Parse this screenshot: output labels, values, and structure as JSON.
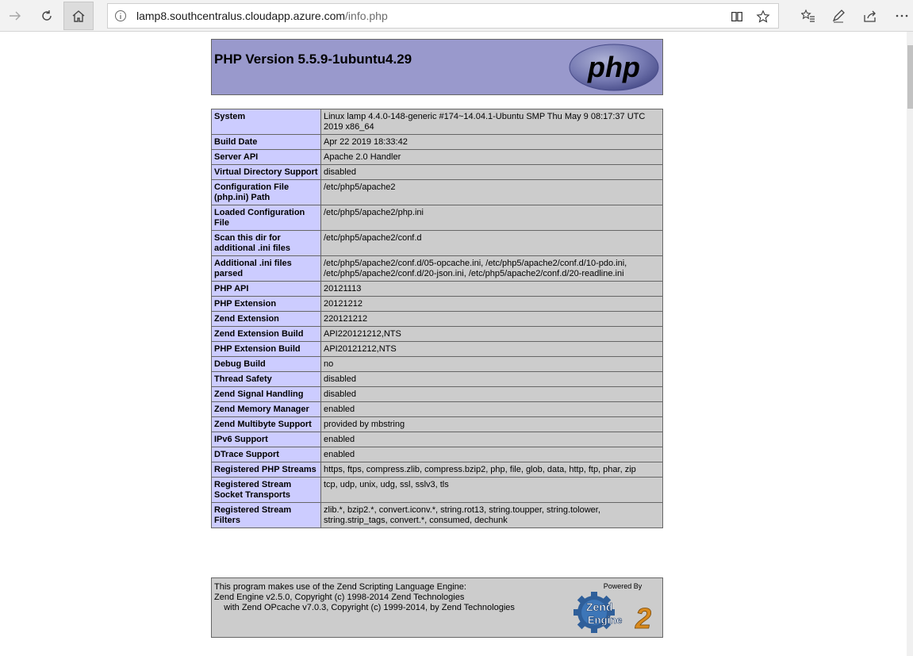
{
  "browser": {
    "url_host": "lamp8.southcentralus.cloudapp.azure.com",
    "url_path": "/info.php"
  },
  "header": {
    "title": "PHP Version 5.5.9-1ubuntu4.29",
    "logo_text": "php"
  },
  "rows": [
    {
      "key": "System",
      "value": "Linux lamp 4.4.0-148-generic #174~14.04.1-Ubuntu SMP Thu May 9 08:17:37 UTC 2019 x86_64"
    },
    {
      "key": "Build Date",
      "value": "Apr 22 2019 18:33:42"
    },
    {
      "key": "Server API",
      "value": "Apache 2.0 Handler"
    },
    {
      "key": "Virtual Directory Support",
      "value": "disabled"
    },
    {
      "key": "Configuration File (php.ini) Path",
      "value": "/etc/php5/apache2"
    },
    {
      "key": "Loaded Configuration File",
      "value": "/etc/php5/apache2/php.ini"
    },
    {
      "key": "Scan this dir for additional .ini files",
      "value": "/etc/php5/apache2/conf.d"
    },
    {
      "key": "Additional .ini files parsed",
      "value": "/etc/php5/apache2/conf.d/05-opcache.ini, /etc/php5/apache2/conf.d/10-pdo.ini, /etc/php5/apache2/conf.d/20-json.ini, /etc/php5/apache2/conf.d/20-readline.ini"
    },
    {
      "key": "PHP API",
      "value": "20121113"
    },
    {
      "key": "PHP Extension",
      "value": "20121212"
    },
    {
      "key": "Zend Extension",
      "value": "220121212"
    },
    {
      "key": "Zend Extension Build",
      "value": "API220121212,NTS"
    },
    {
      "key": "PHP Extension Build",
      "value": "API20121212,NTS"
    },
    {
      "key": "Debug Build",
      "value": "no"
    },
    {
      "key": "Thread Safety",
      "value": "disabled"
    },
    {
      "key": "Zend Signal Handling",
      "value": "disabled"
    },
    {
      "key": "Zend Memory Manager",
      "value": "enabled"
    },
    {
      "key": "Zend Multibyte Support",
      "value": "provided by mbstring"
    },
    {
      "key": "IPv6 Support",
      "value": "enabled"
    },
    {
      "key": "DTrace Support",
      "value": "enabled"
    },
    {
      "key": "Registered PHP Streams",
      "value": "https, ftps, compress.zlib, compress.bzip2, php, file, glob, data, http, ftp, phar, zip"
    },
    {
      "key": "Registered Stream Socket Transports",
      "value": "tcp, udp, unix, udg, ssl, sslv3, tls"
    },
    {
      "key": "Registered Stream Filters",
      "value": "zlib.*, bzip2.*, convert.iconv.*, string.rot13, string.toupper, string.tolower, string.strip_tags, convert.*, consumed, dechunk"
    }
  ],
  "footer": {
    "line1": "This program makes use of the Zend Scripting Language Engine:",
    "line2": "Zend Engine v2.5.0, Copyright (c) 1998-2014 Zend Technologies",
    "line3": "    with Zend OPcache v7.0.3, Copyright (c) 1999-2014, by Zend Technologies",
    "powered_by": "Powered By",
    "zend_logo_text": "Zend Engine 2"
  },
  "colors": {
    "header_bg": "#9999cc",
    "key_bg": "#ccccff",
    "value_bg": "#cccccc",
    "border": "#666666"
  }
}
